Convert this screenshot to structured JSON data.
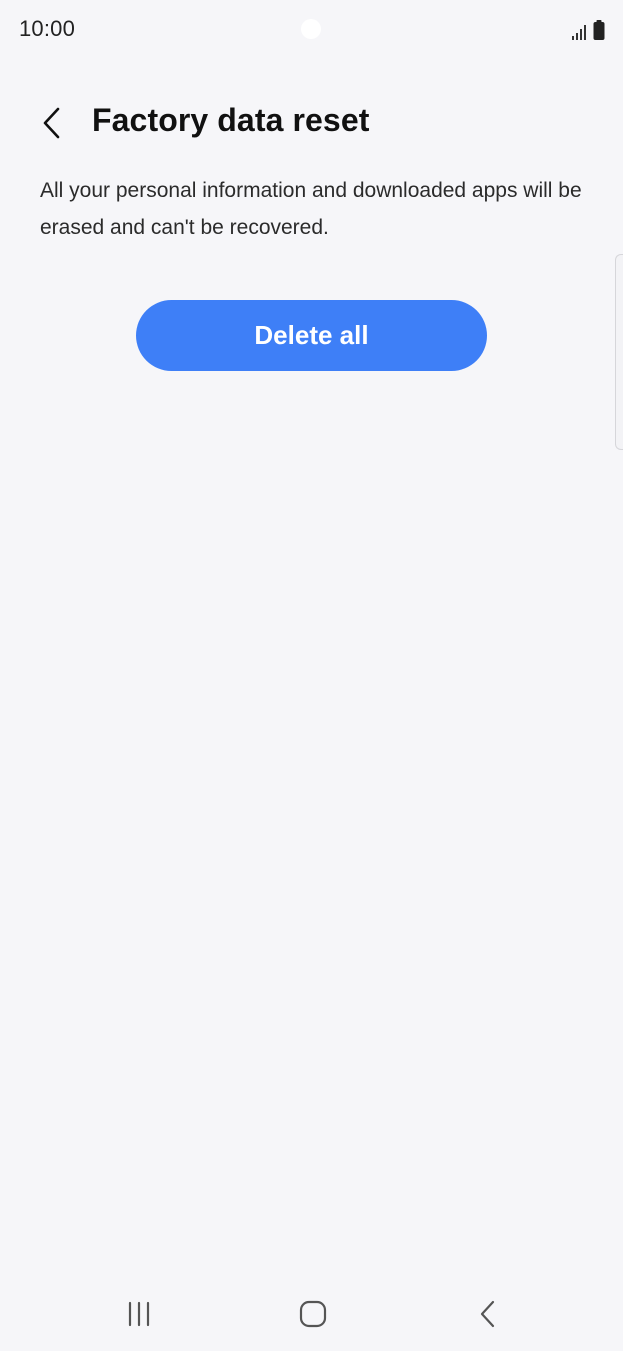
{
  "status_bar": {
    "time": "10:00",
    "icons": [
      "signal-icon",
      "battery-icon"
    ]
  },
  "header": {
    "back_icon": "chevron-left-icon",
    "title": "Factory data reset"
  },
  "main": {
    "description": "All your personal information and downloaded apps will be erased and can't be recovered.",
    "delete_button_label": "Delete all"
  },
  "navigation_bar": {
    "icons": [
      "recents-icon",
      "home-icon",
      "back-icon"
    ]
  },
  "colors": {
    "background": "#f6f6f9",
    "accent": "#3e7ff7",
    "title_text": "#111111",
    "body_text": "#2b2b2b"
  }
}
